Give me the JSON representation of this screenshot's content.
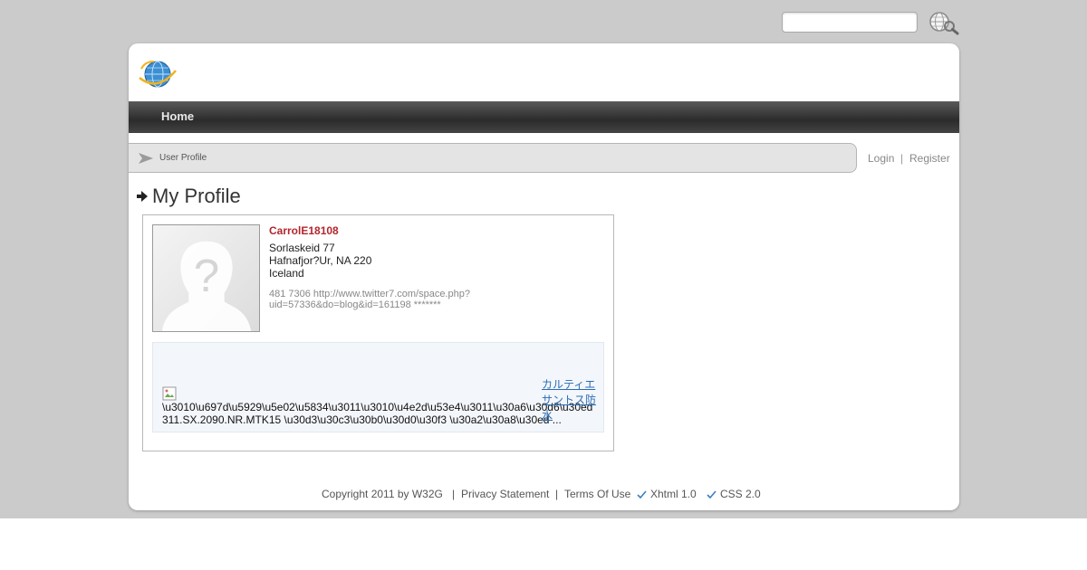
{
  "search": {
    "placeholder": "",
    "value": ""
  },
  "nav": {
    "home": "Home"
  },
  "breadcrumb": {
    "current": "User Profile"
  },
  "account": {
    "login": "Login",
    "separator": "|",
    "register": "Register"
  },
  "page": {
    "title": "My Profile"
  },
  "profile": {
    "username": "CarrolE18108",
    "address_line1": "Sorlaskeid 77",
    "address_line2": "Hafnafjor?Ur, NA 220",
    "country": "Iceland",
    "misc": "481 7306 http://www.twitter7.com/space.php?uid=57336&do=blog&id=161198 *******"
  },
  "ad": {
    "text": "\\u3010\\u697d\\u5929\\u5e02\\u5834\\u3011\\u3010\\u4e2d\\u53e4\\u3011\\u30a6\\u30d6\\u30ed311.SX.2090.NR.MTK15 \\u30d3\\u30c3\\u30b0\\u30d0\\u30f3 \\u30a2\\u30a8\\u30ed ...",
    "link": "カルティエサントス防水"
  },
  "footer": {
    "copyright": "Copyright 2011 by W32G",
    "sep": "|",
    "privacy": "Privacy Statement",
    "terms": "Terms Of Use",
    "xhtml": "Xhtml 1.0",
    "css": "CSS 2.0"
  },
  "colors": {
    "accent_red": "#b3262d",
    "link_blue": "#2a6db5",
    "nav_dark": "#2b2b2b"
  },
  "icons": [
    "search-globe-icon",
    "site-logo-globe-icon",
    "breadcrumb-arrow-icon",
    "title-arrow-icon",
    "avatar-placeholder-icon",
    "broken-image-icon",
    "check-icon"
  ]
}
